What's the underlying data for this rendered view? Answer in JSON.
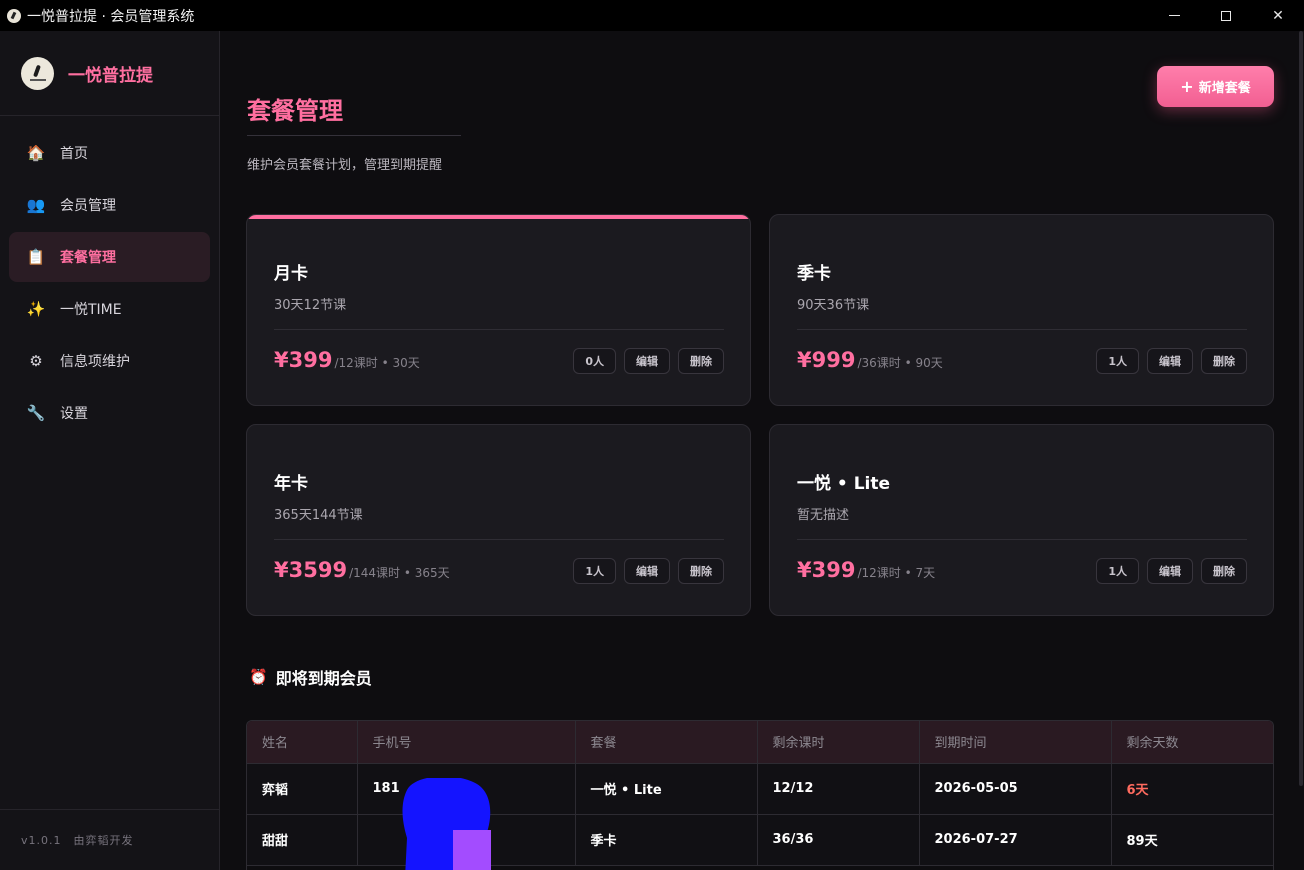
{
  "window": {
    "title": "一悦普拉提 · 会员管理系统",
    "controls": {
      "minimize": "—",
      "maximize": "□",
      "close": "✕"
    }
  },
  "sidebar": {
    "brand": "一悦普拉提",
    "items": [
      {
        "label": "首页",
        "icon": "house-icon",
        "glyph": "🏠",
        "active": false
      },
      {
        "label": "会员管理",
        "icon": "users-icon",
        "glyph": "👥",
        "active": false
      },
      {
        "label": "套餐管理",
        "icon": "clipboard-icon",
        "glyph": "📋",
        "active": true
      },
      {
        "label": "一悦TIME",
        "icon": "sparkles-icon",
        "glyph": "✨",
        "active": false
      },
      {
        "label": "信息项维护",
        "icon": "gear-icon",
        "glyph": "⚙",
        "active": false
      },
      {
        "label": "设置",
        "icon": "wrench-icon",
        "glyph": "🔧",
        "active": false
      }
    ],
    "footer": {
      "version": "v1.0.1",
      "credit": "由弈韬开发"
    }
  },
  "header": {
    "title": "套餐管理",
    "subtitle": "维护会员套餐计划，管理到期提醒",
    "add_button": "新增套餐",
    "add_button_glyph": "+"
  },
  "plans": [
    {
      "name": "月卡",
      "desc": "30天12节课",
      "price": "¥399",
      "detail": "/12课时 • 30天",
      "members": "0人"
    },
    {
      "name": "季卡",
      "desc": "90天36节课",
      "price": "¥999",
      "detail": "/36课时 • 90天",
      "members": "1人"
    },
    {
      "name": "年卡",
      "desc": "365天144节课",
      "price": "¥3599",
      "detail": "/144课时 • 365天",
      "members": "1人"
    },
    {
      "name": "一悦 • Lite",
      "desc": "暂无描述",
      "price": "¥399",
      "detail": "/12课时 • 7天",
      "members": "1人"
    }
  ],
  "plan_actions": {
    "edit": "编辑",
    "delete": "删除"
  },
  "expiring": {
    "title": "即将到期会员",
    "icon": "alarm-clock-icon",
    "glyph": "⏰",
    "columns": [
      "姓名",
      "手机号",
      "套餐",
      "剩余课时",
      "到期时间",
      "剩余天数"
    ],
    "rows": [
      {
        "name": "弈韬",
        "phone": "181",
        "plan": "一悦 • Lite",
        "lessons": "12/12",
        "expire": "2026-05-05",
        "days": "6天",
        "urgent": true
      },
      {
        "name": "甜甜",
        "phone": "",
        "plan": "季卡",
        "lessons": "36/36",
        "expire": "2026-07-27",
        "days": "89天",
        "urgent": false
      }
    ]
  },
  "colors": {
    "accent": "#ff6fa0",
    "urgent": "#ff6b5f",
    "redact_blue": "#1414ff",
    "redact_purple": "#a34cff"
  }
}
